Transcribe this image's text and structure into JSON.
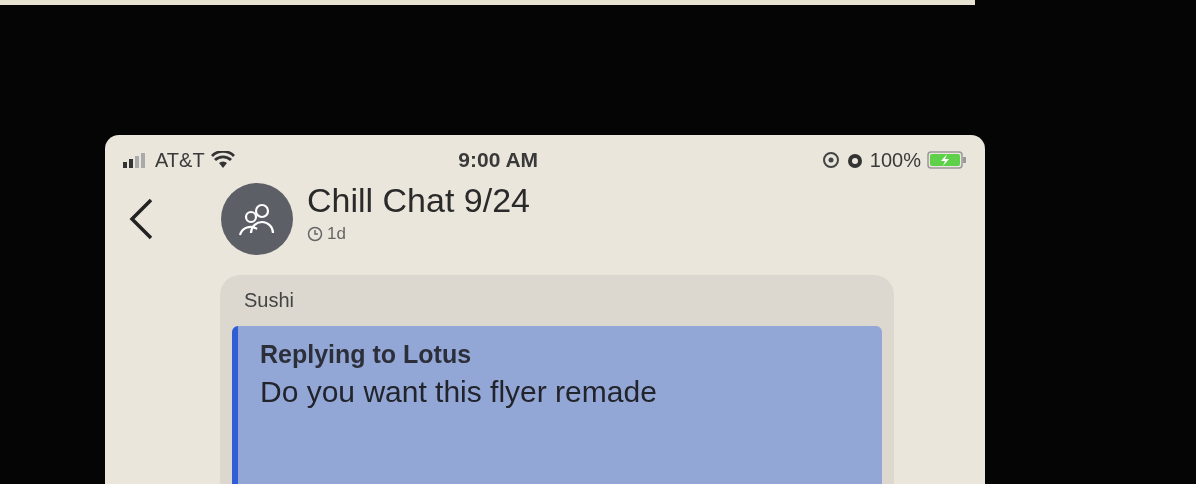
{
  "status_bar": {
    "carrier": "AT&T",
    "time": "9:00 AM",
    "battery": "100%",
    "charging": true
  },
  "header": {
    "title": "Chill Chat 9/24",
    "timer": "1d"
  },
  "messages": [
    {
      "sender": "Sushi",
      "reply": {
        "label": "Replying to Lotus",
        "text": "Do you want this flyer remade"
      }
    }
  ]
}
